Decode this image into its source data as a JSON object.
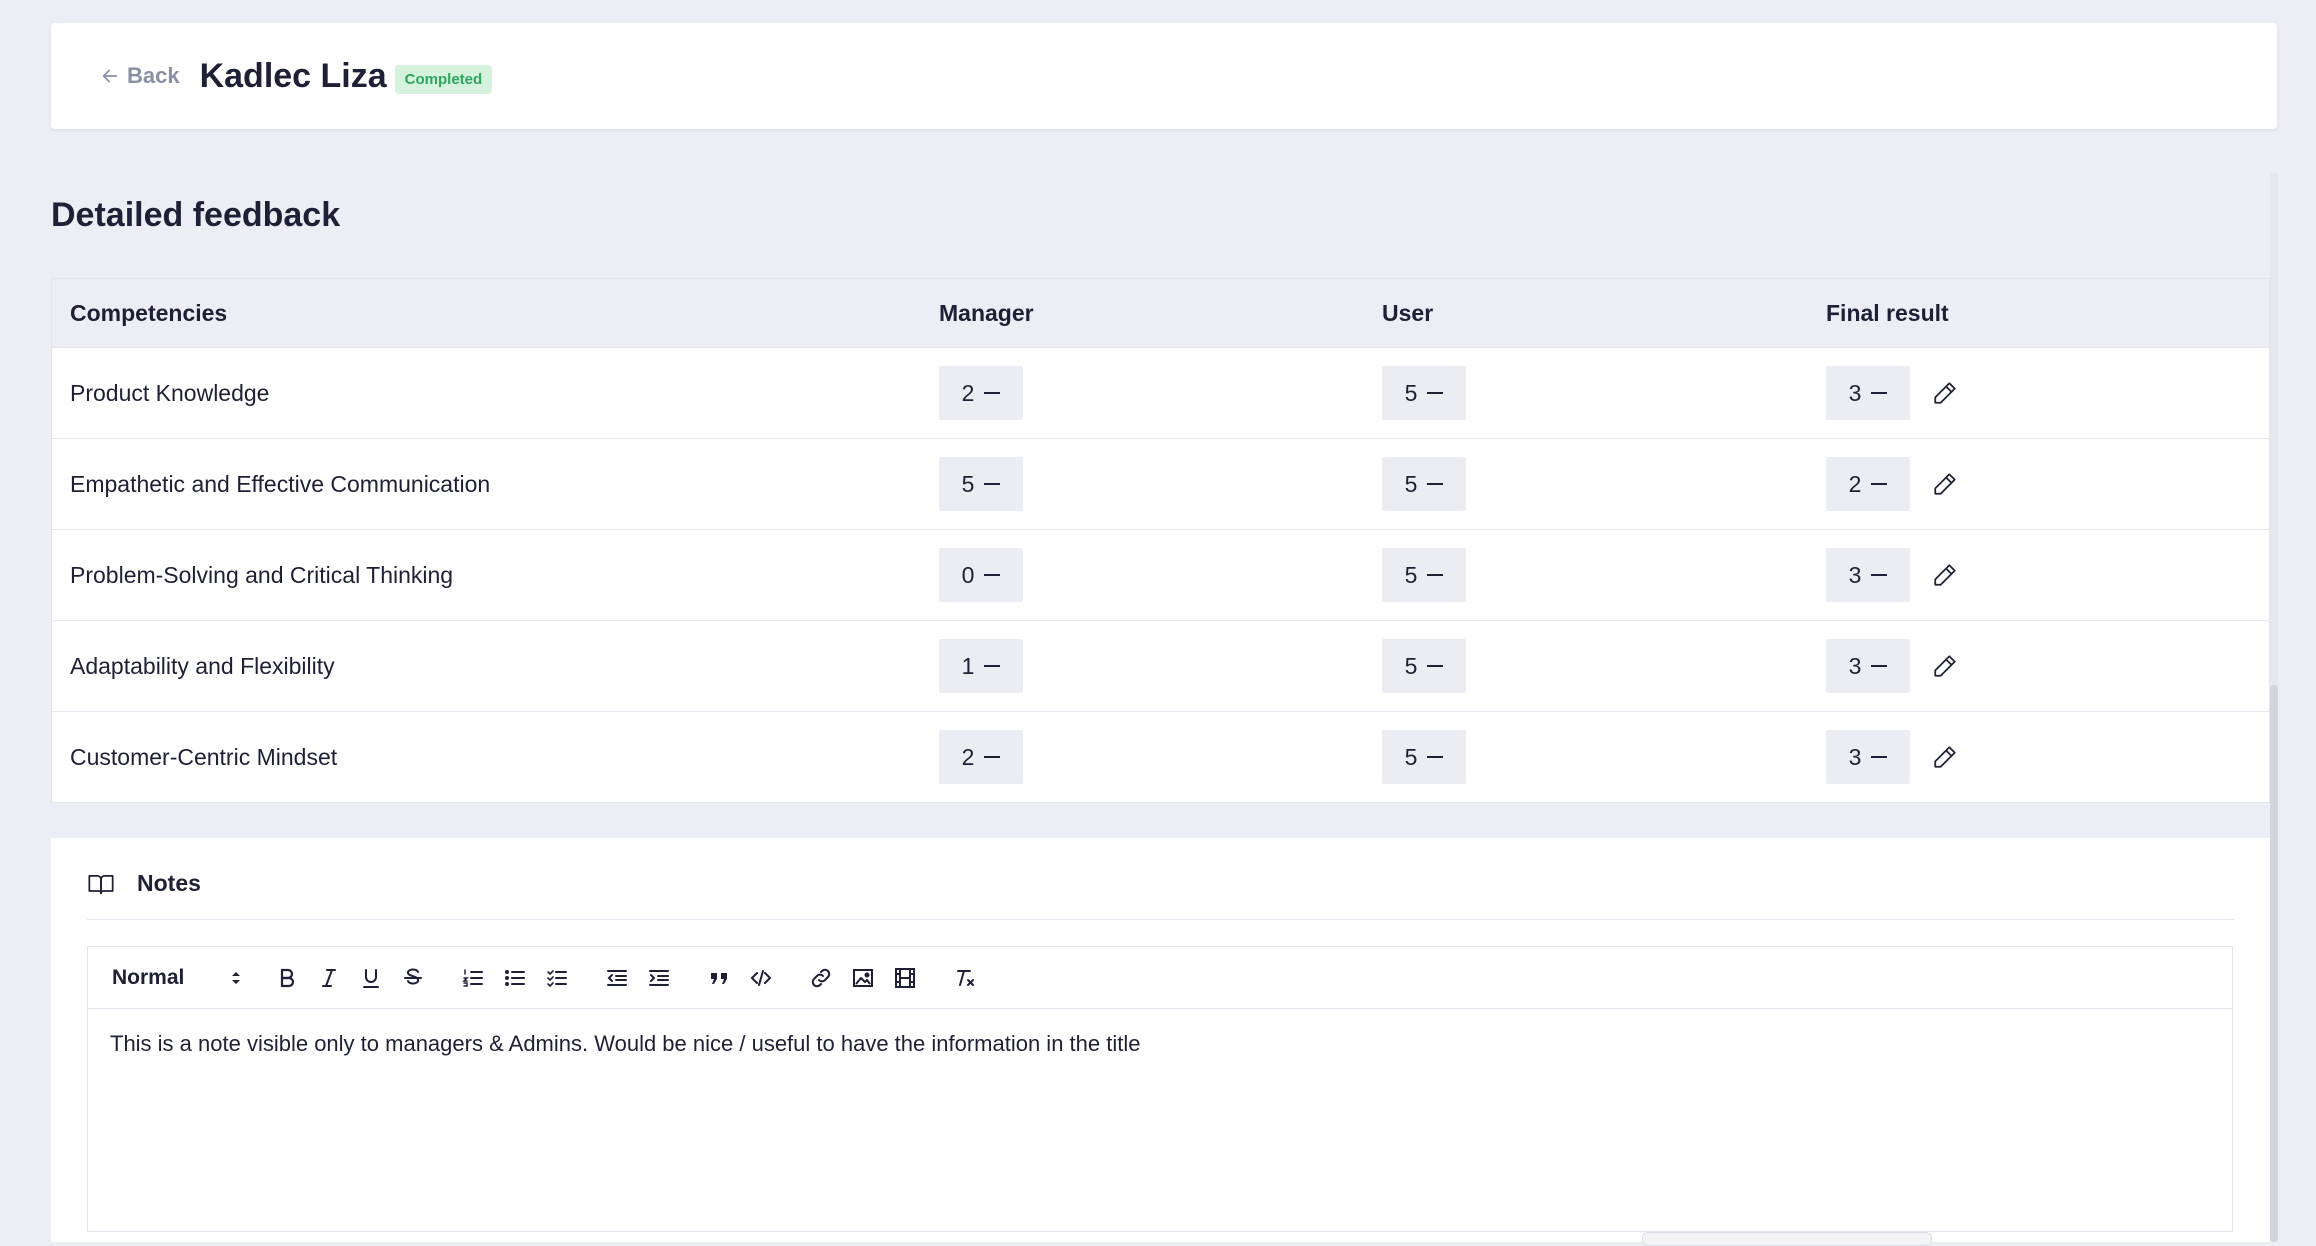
{
  "header": {
    "back_label": "Back",
    "name": "Kadlec Liza",
    "status": "Completed"
  },
  "section_title": "Detailed feedback",
  "table": {
    "columns": [
      "Competencies",
      "Manager",
      "User",
      "Final result"
    ],
    "rows": [
      {
        "competency": "Product Knowledge",
        "manager": "2",
        "user": "5",
        "final": "3"
      },
      {
        "competency": "Empathetic and Effective Communication",
        "manager": "5",
        "user": "5",
        "final": "2"
      },
      {
        "competency": "Problem-Solving and Critical Thinking",
        "manager": "0",
        "user": "5",
        "final": "3"
      },
      {
        "competency": "Adaptability and Flexibility",
        "manager": "1",
        "user": "5",
        "final": "3"
      },
      {
        "competency": "Customer-Centric Mindset",
        "manager": "2",
        "user": "5",
        "final": "3"
      }
    ]
  },
  "notes": {
    "title": "Notes",
    "format_value": "Normal",
    "content": "This is a note visible only to managers & Admins. Would be nice / useful to have the information in the title"
  },
  "colors": {
    "page_bg": "#ecedf5",
    "badge_bg": "#d4f2dc",
    "badge_text": "#2ea55a",
    "text": "#1e2035"
  }
}
